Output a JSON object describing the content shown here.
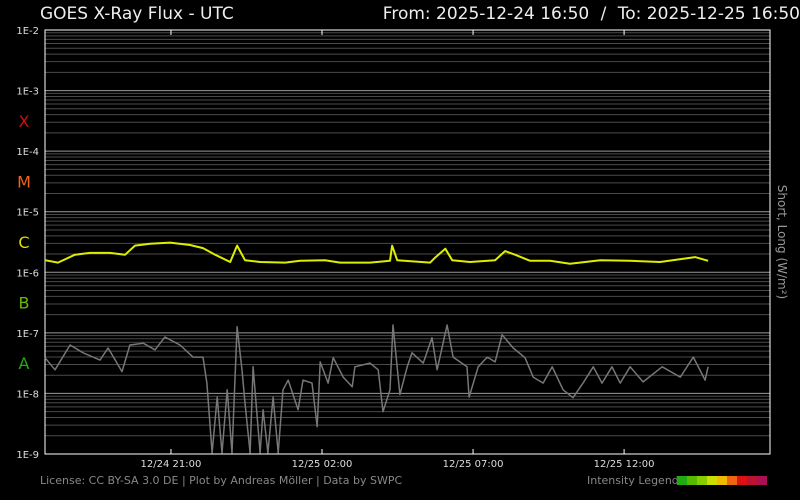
{
  "header": {
    "title": "GOES X-Ray Flux - UTC",
    "from_label": "From: 2025-12-24 16:50",
    "separator": "/",
    "to_label": "To: 2025-12-25 16:50"
  },
  "footer": {
    "license": "License: CC BY-SA 3.0 DE | Plot by Andreas Möller | Data by SWPC",
    "legend_label": "Intensity Legend",
    "legend_colors": [
      "#22aa11",
      "#55bb00",
      "#88cc00",
      "#ccdd00",
      "#eebb00",
      "#ee6611",
      "#dd1111",
      "#bb1133",
      "#aa1155"
    ]
  },
  "chart_data": {
    "type": "line",
    "title": "GOES X-Ray Flux - UTC",
    "xlabel": "",
    "ylabel": "Short, Long (W/m²)",
    "x_unit": "hours since 2025-12-24 16:50 UTC",
    "xlim": [
      0,
      24
    ],
    "ylim_log10": [
      -9,
      -2
    ],
    "y_scale": "log",
    "grid": true,
    "y_ticks": [
      {
        "log": -2,
        "label": "1E-2"
      },
      {
        "log": -3,
        "label": "1E-3"
      },
      {
        "log": -4,
        "label": "1E-4"
      },
      {
        "log": -5,
        "label": "1E-5"
      },
      {
        "log": -6,
        "label": "1E-6"
      },
      {
        "log": -7,
        "label": "1E-7"
      },
      {
        "log": -8,
        "label": "1E-8"
      },
      {
        "log": -9,
        "label": "1E-9"
      }
    ],
    "x_ticks": [
      {
        "h": 4.17,
        "label": "12/24 21:00"
      },
      {
        "h": 9.17,
        "label": "12/25 02:00"
      },
      {
        "h": 14.17,
        "label": "12/25 07:00"
      },
      {
        "h": 19.17,
        "label": "12/25 12:00"
      }
    ],
    "classes": [
      {
        "label": "X",
        "log": -3.5,
        "color": "#cc1111"
      },
      {
        "label": "M",
        "log": -4.5,
        "color": "#ee6611"
      },
      {
        "label": "C",
        "log": -5.5,
        "color": "#dddd00"
      },
      {
        "label": "B",
        "log": -6.5,
        "color": "#66bb00"
      },
      {
        "label": "A",
        "log": -7.5,
        "color": "#22aa11"
      }
    ],
    "series": [
      {
        "name": "Long",
        "color": "#ddee00",
        "h": [
          0,
          0.43,
          0.99,
          1.49,
          2.15,
          2.65,
          2.98,
          3.48,
          4.14,
          4.8,
          5.23,
          5.63,
          6.13,
          6.36,
          6.62,
          7.12,
          7.95,
          8.44,
          9.27,
          9.77,
          10.76,
          11.42,
          11.49,
          11.66,
          12.75,
          12.91,
          13.25,
          13.48,
          14.07,
          14.9,
          15.23,
          15.56,
          16.06,
          16.72,
          17.38,
          18.38,
          19.37,
          20.36,
          21.52,
          21.95
        ],
        "log": [
          -5.8,
          -5.84,
          -5.71,
          -5.68,
          -5.68,
          -5.71,
          -5.56,
          -5.53,
          -5.51,
          -5.55,
          -5.6,
          -5.71,
          -5.83,
          -5.56,
          -5.8,
          -5.83,
          -5.84,
          -5.81,
          -5.8,
          -5.84,
          -5.84,
          -5.81,
          -5.56,
          -5.8,
          -5.84,
          -5.76,
          -5.61,
          -5.8,
          -5.83,
          -5.8,
          -5.65,
          -5.71,
          -5.81,
          -5.81,
          -5.86,
          -5.8,
          -5.81,
          -5.83,
          -5.75,
          -5.81
        ]
      },
      {
        "name": "Short",
        "color": "#777777",
        "h": [
          0,
          0.33,
          0.83,
          1.26,
          1.82,
          2.09,
          2.55,
          2.81,
          3.25,
          3.64,
          3.97,
          4.47,
          4.9,
          5.23,
          5.36,
          5.53,
          5.7,
          5.86,
          6.03,
          6.19,
          6.36,
          6.52,
          6.62,
          6.79,
          6.89,
          7.12,
          7.22,
          7.38,
          7.55,
          7.72,
          7.88,
          8.05,
          8.38,
          8.54,
          8.84,
          9.01,
          9.11,
          9.37,
          9.54,
          9.87,
          10.17,
          10.26,
          10.76,
          11.03,
          11.19,
          11.42,
          11.52,
          11.75,
          11.99,
          12.15,
          12.52,
          12.81,
          12.98,
          13.31,
          13.51,
          13.97,
          14.04,
          14.34,
          14.64,
          14.9,
          15.13,
          15.5,
          15.89,
          16.16,
          16.49,
          16.79,
          17.15,
          17.48,
          17.81,
          18.15,
          18.44,
          18.77,
          19.04,
          19.37,
          19.8,
          20.43,
          21.03,
          21.46,
          21.85,
          21.95
        ],
        "log": [
          -7.41,
          -7.61,
          -7.2,
          -7.33,
          -7.45,
          -7.25,
          -7.64,
          -7.2,
          -7.17,
          -7.28,
          -7.07,
          -7.2,
          -7.4,
          -7.4,
          -7.83,
          -8.98,
          -8.06,
          -8.98,
          -7.94,
          -8.98,
          -6.9,
          -7.61,
          -8.16,
          -8.98,
          -7.56,
          -8.98,
          -8.27,
          -8.98,
          -8.06,
          -8.98,
          -7.94,
          -7.78,
          -8.27,
          -7.78,
          -7.83,
          -8.55,
          -7.48,
          -7.83,
          -7.41,
          -7.73,
          -7.89,
          -7.56,
          -7.5,
          -7.61,
          -8.3,
          -7.94,
          -6.87,
          -8.02,
          -7.56,
          -7.33,
          -7.5,
          -7.08,
          -7.61,
          -6.87,
          -7.4,
          -7.56,
          -8.06,
          -7.56,
          -7.4,
          -7.48,
          -7.03,
          -7.25,
          -7.41,
          -7.73,
          -7.83,
          -7.56,
          -7.94,
          -8.07,
          -7.83,
          -7.56,
          -7.83,
          -7.56,
          -7.83,
          -7.56,
          -7.81,
          -7.56,
          -7.73,
          -7.4,
          -7.78,
          -7.56
        ]
      }
    ]
  }
}
